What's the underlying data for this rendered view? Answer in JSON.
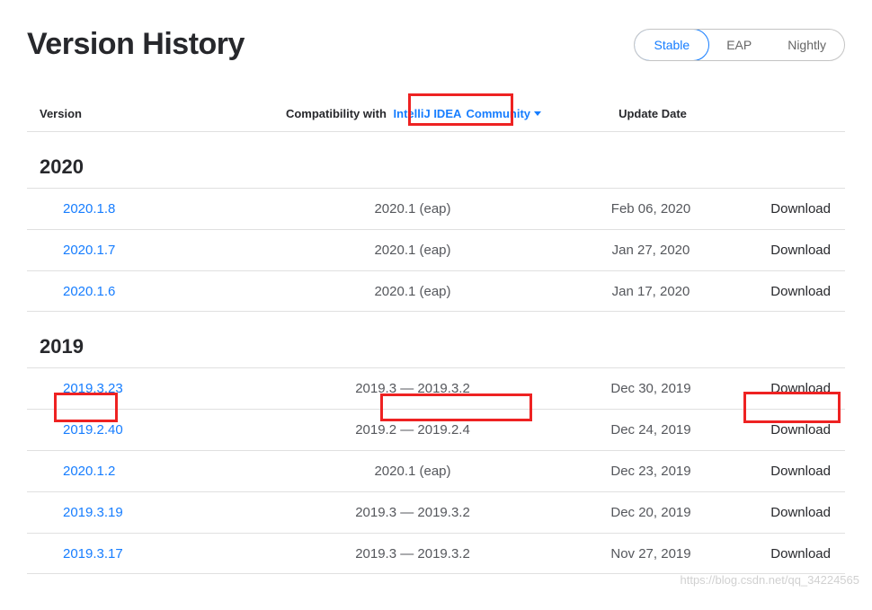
{
  "page_title": "Version History",
  "channels": {
    "items": [
      "Stable",
      "EAP",
      "Nightly"
    ],
    "active": "Stable"
  },
  "columns": {
    "version": "Version",
    "compat_label": "Compatibility with",
    "compat_ide": "IntelliJ IDEA",
    "compat_dropdown": "Community",
    "update_date": "Update Date"
  },
  "download_label": "Download",
  "groups": [
    {
      "year": "2020",
      "rows": [
        {
          "version": "2020.1.8",
          "compat": "2020.1 (eap)",
          "date": "Feb 06, 2020"
        },
        {
          "version": "2020.1.7",
          "compat": "2020.1 (eap)",
          "date": "Jan 27, 2020"
        },
        {
          "version": "2020.1.6",
          "compat": "2020.1 (eap)",
          "date": "Jan 17, 2020"
        }
      ]
    },
    {
      "year": "2019",
      "rows": [
        {
          "version": "2019.3.23",
          "compat": "2019.3 — 2019.3.2",
          "date": "Dec 30, 2019"
        },
        {
          "version": "2019.2.40",
          "compat": "2019.2 — 2019.2.4",
          "date": "Dec 24, 2019"
        },
        {
          "version": "2020.1.2",
          "compat": "2020.1 (eap)",
          "date": "Dec 23, 2019"
        },
        {
          "version": "2019.3.19",
          "compat": "2019.3 — 2019.3.2",
          "date": "Dec 20, 2019"
        },
        {
          "version": "2019.3.17",
          "compat": "2019.3 — 2019.3.2",
          "date": "Nov 27, 2019"
        }
      ]
    }
  ],
  "watermark": "https://blog.csdn.net/qq_34224565"
}
